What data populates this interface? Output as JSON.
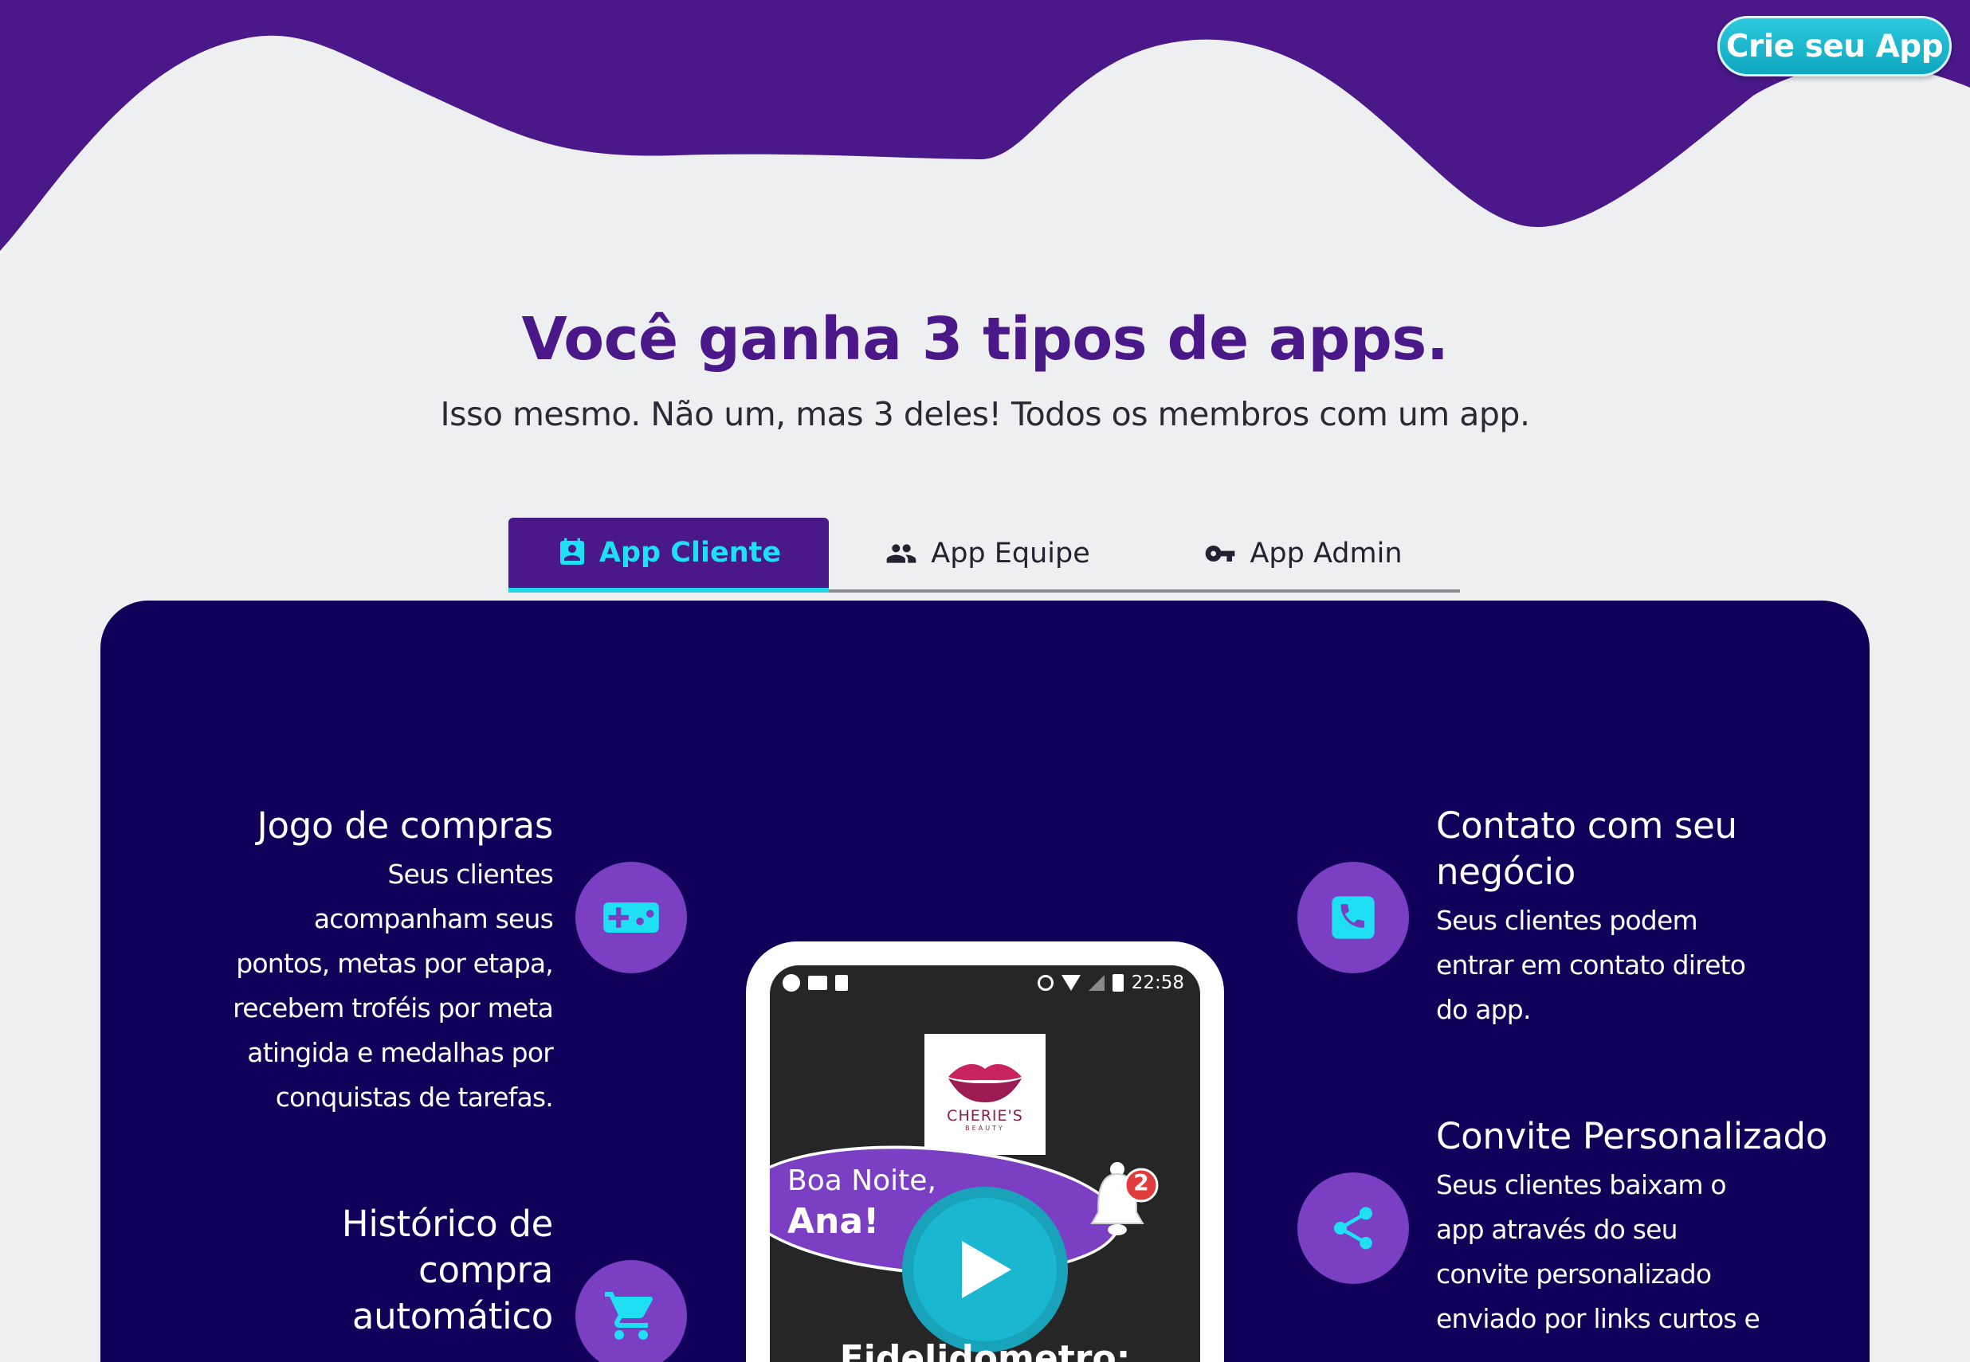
{
  "header": {
    "cta_label": "Crie seu App",
    "colors": {
      "wave": "#4a1889",
      "background": "#edeff0",
      "cta": "#17b7cd"
    }
  },
  "hero": {
    "title_lead": "Você ganha ",
    "title_bold": "3 tipos de apps",
    "title_end": ".",
    "subtitle": "Isso mesmo. Não um, mas 3 deles! Todos os membros com um app."
  },
  "tabs": [
    {
      "label": "App Cliente",
      "icon": "contact-card-icon",
      "active": true
    },
    {
      "label": "App Equipe",
      "icon": "group-icon",
      "active": false
    },
    {
      "label": "App Admin",
      "icon": "key-icon",
      "active": false
    }
  ],
  "features_left": [
    {
      "title": "Jogo de compras",
      "lines": [
        "Seus clientes",
        "acompanham seus",
        "pontos, metas por etapa,",
        "recebem troféis por meta",
        "atingida e medalhas por",
        "conquistas de tarefas."
      ],
      "icon": "gamepad-icon"
    },
    {
      "title_lines": [
        "Histórico de",
        "compra",
        "automático"
      ],
      "icon": "cart-icon"
    }
  ],
  "features_right": [
    {
      "title_lines": [
        "Contato com seu",
        "negócio"
      ],
      "lines": [
        "Seus clientes podem",
        "entrar em contato direto",
        "do app."
      ],
      "icon": "phone-icon"
    },
    {
      "title": "Convite Personalizado",
      "lines": [
        "Seus clientes baixam o",
        "app através do seu",
        "convite personalizado",
        "enviado por links curtos e"
      ],
      "icon": "share-icon"
    }
  ],
  "phone": {
    "time": "22:58",
    "logo_text": "CHERIE'S",
    "logo_sub": "BEAUTY",
    "greeting_line1": "Boa Noite,",
    "greeting_line2": "Ana!",
    "notification_count": "2",
    "bottom_text": "Fidelidometro:"
  },
  "colors": {
    "panel": "#11005a",
    "circle": "#7b3fc4",
    "icon_accent": "#1fe0f2"
  }
}
